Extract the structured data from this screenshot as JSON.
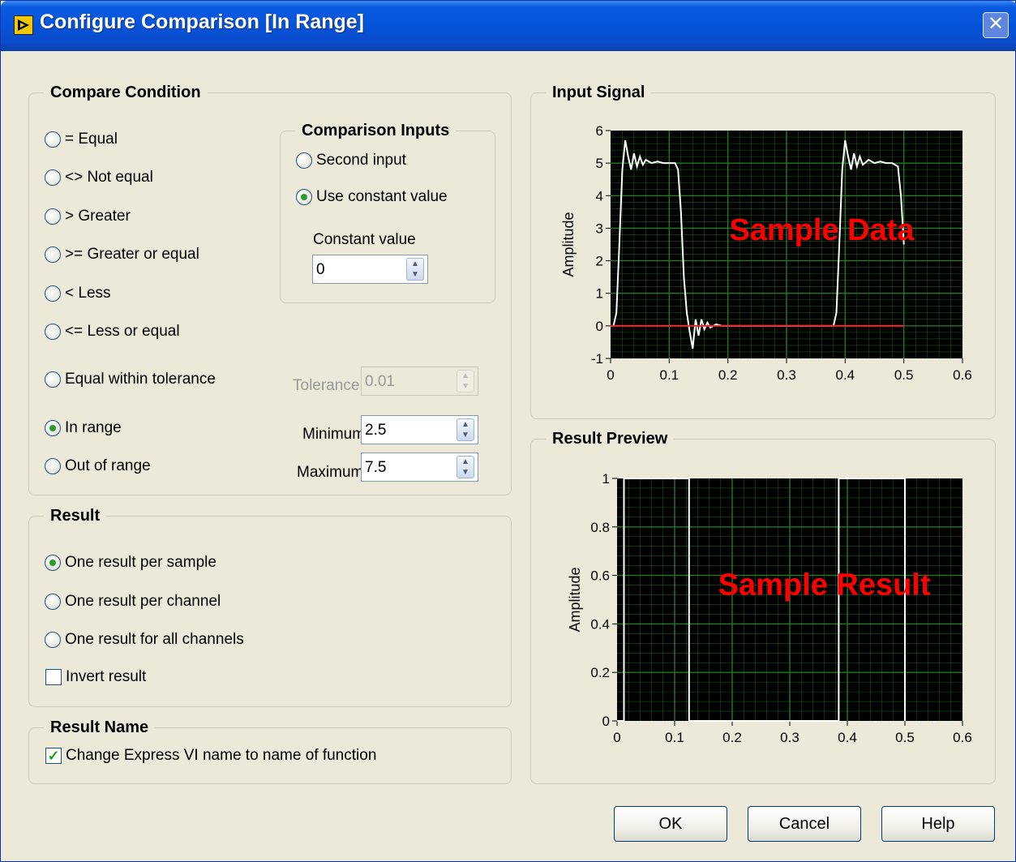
{
  "window": {
    "title": "Configure Comparison [In Range]",
    "close_glyph": "✕"
  },
  "compare_condition": {
    "title": "Compare Condition",
    "options": [
      {
        "label": "= Equal",
        "selected": false
      },
      {
        "label": "<> Not equal",
        "selected": false
      },
      {
        "label": "> Greater",
        "selected": false
      },
      {
        "label": ">= Greater or equal",
        "selected": false
      },
      {
        "label": "< Less",
        "selected": false
      },
      {
        "label": "<= Less or equal",
        "selected": false
      },
      {
        "label": "Equal within tolerance",
        "selected": false
      },
      {
        "label": "In range",
        "selected": true
      },
      {
        "label": "Out of range",
        "selected": false
      }
    ],
    "tolerance": {
      "label": "Tolerance",
      "value": "0.01",
      "enabled": false
    },
    "minimum": {
      "label": "Minimum",
      "value": "2.5"
    },
    "maximum": {
      "label": "Maximum",
      "value": "7.5"
    }
  },
  "comparison_inputs": {
    "title": "Comparison Inputs",
    "options": [
      {
        "label": "Second input",
        "selected": false
      },
      {
        "label": "Use constant value",
        "selected": true
      }
    ],
    "constant_value": {
      "label": "Constant value",
      "value": "0"
    }
  },
  "result": {
    "title": "Result",
    "options": [
      {
        "label": "One result per sample",
        "selected": true
      },
      {
        "label": "One result per channel",
        "selected": false
      },
      {
        "label": "One result for all channels",
        "selected": false
      }
    ],
    "invert": {
      "label": "Invert result",
      "checked": false
    }
  },
  "result_name": {
    "title": "Result Name",
    "change_name": {
      "label": "Change Express VI name to name of function",
      "checked": true
    }
  },
  "buttons": {
    "ok": "OK",
    "cancel": "Cancel",
    "help": "Help"
  },
  "colors": {
    "plot_bg": "#000000",
    "grid": "#1f7a1f",
    "trace": "#ffffff",
    "threshold": "#ff2020",
    "overlay": "#ff0000"
  },
  "chart_data": [
    {
      "type": "line",
      "title": "Input Signal",
      "overlay_label": "Sample Data",
      "ylabel": "Amplitude",
      "xlabel": "",
      "xlim": [
        0,
        0.6
      ],
      "ylim": [
        -1,
        6
      ],
      "xticks": [
        "0",
        "0.1",
        "0.2",
        "0.3",
        "0.4",
        "0.5",
        "0.6"
      ],
      "yticks": [
        "-1",
        "0",
        "1",
        "2",
        "3",
        "4",
        "5",
        "6"
      ],
      "grid": true,
      "series": [
        {
          "x": [
            0,
            0.005,
            0.01,
            0.015,
            0.02,
            0.025,
            0.03,
            0.035,
            0.04,
            0.045,
            0.05,
            0.055,
            0.06,
            0.07,
            0.08,
            0.09,
            0.1,
            0.11,
            0.115,
            0.12,
            0.125,
            0.13,
            0.135,
            0.14,
            0.145,
            0.15,
            0.155,
            0.16,
            0.165,
            0.17,
            0.18,
            0.19,
            0.2,
            0.22,
            0.24,
            0.26,
            0.28,
            0.3,
            0.33,
            0.36,
            0.38,
            0.385,
            0.39,
            0.395,
            0.4,
            0.405,
            0.41,
            0.415,
            0.42,
            0.425,
            0.43,
            0.44,
            0.45,
            0.46,
            0.47,
            0.48,
            0.49,
            0.495,
            0.5
          ],
          "values": [
            0,
            0,
            0.4,
            2.5,
            4.8,
            5.7,
            5.2,
            4.8,
            5.3,
            4.9,
            5.2,
            4.95,
            5.1,
            5.0,
            5.05,
            5.0,
            5.0,
            5.0,
            4.8,
            3.5,
            1.5,
            0.4,
            -0.2,
            -0.7,
            0.2,
            -0.3,
            0.2,
            -0.1,
            0.1,
            -0.05,
            0.05,
            0,
            0,
            0,
            0,
            0,
            0,
            0,
            0,
            0,
            0,
            0.4,
            2.5,
            4.8,
            5.7,
            5.2,
            4.8,
            5.3,
            4.9,
            5.2,
            4.95,
            5.1,
            5.0,
            5.05,
            5.0,
            5.0,
            4.9,
            4.0,
            2.5
          ]
        },
        {
          "x": [
            0,
            0.5
          ],
          "values": [
            0,
            0
          ]
        }
      ]
    },
    {
      "type": "line",
      "title": "Result Preview",
      "overlay_label": "Sample Result",
      "ylabel": "Amplitude",
      "xlabel": "",
      "xlim": [
        0,
        0.6
      ],
      "ylim": [
        0,
        1
      ],
      "xticks": [
        "0",
        "0.1",
        "0.2",
        "0.3",
        "0.4",
        "0.5",
        "0.6"
      ],
      "yticks": [
        "0",
        "0.2",
        "0.4",
        "0.6",
        "0.8",
        "1"
      ],
      "grid": true,
      "series": [
        {
          "x": [
            0,
            0.012,
            0.012,
            0.125,
            0.125,
            0.385,
            0.385,
            0.5,
            0.5
          ],
          "values": [
            0,
            0,
            1,
            1,
            0,
            0,
            1,
            1,
            0
          ]
        }
      ]
    }
  ]
}
